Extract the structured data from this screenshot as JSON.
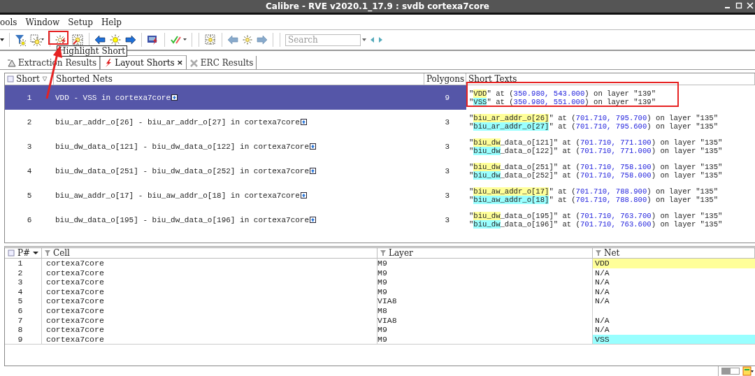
{
  "window": {
    "title": "Calibre - RVE v2020.1_17.9 : svdb cortexa7core"
  },
  "menu": [
    {
      "label": "ools"
    },
    {
      "label": "Window"
    },
    {
      "label": "Setup"
    },
    {
      "label": "Help"
    }
  ],
  "search": {
    "placeholder": "Search"
  },
  "tooltip": "Highlight Short",
  "tabs": [
    {
      "label": "Extraction Results",
      "kind": "extraction",
      "selected": false
    },
    {
      "label": "Layout Shorts",
      "kind": "shorts",
      "selected": true,
      "close": "×"
    },
    {
      "label": "ERC Results",
      "kind": "erc",
      "selected": false
    }
  ],
  "shorts": {
    "columns": [
      "Short",
      "Shorted Nets",
      "Polygons",
      "Short Texts"
    ],
    "rows": [
      {
        "number": "1",
        "nets": "VDD - VSS in cortexa7core",
        "polygons": "9",
        "selected": true,
        "texts": [
          {
            "color": "#ffff99",
            "segments": [
              {
                "kind": "plain",
                "text": "\""
              },
              {
                "kind": "name",
                "text": "VDD"
              },
              {
                "kind": "plain",
                "text": "\" at ("
              },
              {
                "kind": "coord",
                "text": "350.980, 543.000"
              },
              {
                "kind": "plain",
                "text": ") on layer \"139\""
              }
            ]
          },
          {
            "color": "#99ffff",
            "segments": [
              {
                "kind": "plain",
                "text": "\""
              },
              {
                "kind": "name",
                "text": "VSS"
              },
              {
                "kind": "plain",
                "text": "\" at ("
              },
              {
                "kind": "coord",
                "text": "350.980, 551.000"
              },
              {
                "kind": "plain",
                "text": ") on layer \"139\""
              }
            ]
          }
        ]
      },
      {
        "number": "2",
        "nets": "biu_ar_addr_o[26] - biu_ar_addr_o[27] in cortexa7core",
        "polygons": "3",
        "selected": false,
        "texts": [
          {
            "color": "#ffff99",
            "segments": [
              {
                "kind": "plain",
                "text": "\""
              },
              {
                "kind": "name",
                "text": "biu_ar_addr_o[26]"
              },
              {
                "kind": "plain",
                "text": "\" at ("
              },
              {
                "kind": "coord",
                "text": "701.710, 795.700"
              },
              {
                "kind": "plain",
                "text": ") on layer \"135\""
              }
            ]
          },
          {
            "color": "#99ffff",
            "segments": [
              {
                "kind": "plain",
                "text": "\""
              },
              {
                "kind": "name",
                "text": "biu_ar_addr_o[27]"
              },
              {
                "kind": "plain",
                "text": "\" at ("
              },
              {
                "kind": "coord",
                "text": "701.710, 795.600"
              },
              {
                "kind": "plain",
                "text": ") on layer \"135\""
              }
            ]
          }
        ]
      },
      {
        "number": "3",
        "nets": "biu_dw_data_o[121] - biu_dw_data_o[122] in cortexa7core",
        "polygons": "3",
        "selected": false,
        "texts": [
          {
            "color": "#ffff99",
            "segments": [
              {
                "kind": "plain",
                "text": "\""
              },
              {
                "kind": "name",
                "text": "biu_dw"
              },
              {
                "kind": "plain",
                "text": "_data_o[121]\" at ("
              },
              {
                "kind": "coord",
                "text": "701.710, 771.100"
              },
              {
                "kind": "plain",
                "text": ") on layer \"135\""
              }
            ]
          },
          {
            "color": "#99ffff",
            "segments": [
              {
                "kind": "plain",
                "text": "\""
              },
              {
                "kind": "name",
                "text": "biu_dw"
              },
              {
                "kind": "plain",
                "text": "_data_o[122]\" at ("
              },
              {
                "kind": "coord",
                "text": "701.710, 771.000"
              },
              {
                "kind": "plain",
                "text": ") on layer \"135\""
              }
            ]
          }
        ]
      },
      {
        "number": "4",
        "nets": "biu_dw_data_o[251] - biu_dw_data_o[252] in cortexa7core",
        "polygons": "3",
        "selected": false,
        "texts": [
          {
            "color": "#ffff99",
            "segments": [
              {
                "kind": "plain",
                "text": "\""
              },
              {
                "kind": "name",
                "text": "biu_dw"
              },
              {
                "kind": "plain",
                "text": "_data_o[251]\" at ("
              },
              {
                "kind": "coord",
                "text": "701.710, 758.100"
              },
              {
                "kind": "plain",
                "text": ") on layer \"135\""
              }
            ]
          },
          {
            "color": "#99ffff",
            "segments": [
              {
                "kind": "plain",
                "text": "\""
              },
              {
                "kind": "name",
                "text": "biu_dw"
              },
              {
                "kind": "plain",
                "text": "_data_o[252]\" at ("
              },
              {
                "kind": "coord",
                "text": "701.710, 758.000"
              },
              {
                "kind": "plain",
                "text": ") on layer \"135\""
              }
            ]
          }
        ]
      },
      {
        "number": "5",
        "nets": "biu_aw_addr_o[17] - biu_aw_addr_o[18] in cortexa7core",
        "polygons": "3",
        "selected": false,
        "texts": [
          {
            "color": "#ffff99",
            "segments": [
              {
                "kind": "plain",
                "text": "\""
              },
              {
                "kind": "name",
                "text": "biu_aw_addr_o[17]"
              },
              {
                "kind": "plain",
                "text": "\" at ("
              },
              {
                "kind": "coord",
                "text": "701.710, 788.900"
              },
              {
                "kind": "plain",
                "text": ") on layer \"135\""
              }
            ]
          },
          {
            "color": "#99ffff",
            "segments": [
              {
                "kind": "plain",
                "text": "\""
              },
              {
                "kind": "name",
                "text": "biu_aw_addr_o[18]"
              },
              {
                "kind": "plain",
                "text": "\" at ("
              },
              {
                "kind": "coord",
                "text": "701.710, 788.800"
              },
              {
                "kind": "plain",
                "text": ") on layer \"135\""
              }
            ]
          }
        ]
      },
      {
        "number": "6",
        "nets": "biu_dw_data_o[195] - biu_dw_data_o[196] in cortexa7core",
        "polygons": "3",
        "selected": false,
        "texts": [
          {
            "color": "#ffff99",
            "segments": [
              {
                "kind": "plain",
                "text": "\""
              },
              {
                "kind": "name",
                "text": "biu_dw"
              },
              {
                "kind": "plain",
                "text": "_data_o[195]\" at ("
              },
              {
                "kind": "coord",
                "text": "701.710, 763.700"
              },
              {
                "kind": "plain",
                "text": ") on layer \"135\""
              }
            ]
          },
          {
            "color": "#99ffff",
            "segments": [
              {
                "kind": "plain",
                "text": "\""
              },
              {
                "kind": "name",
                "text": "biu_dw"
              },
              {
                "kind": "plain",
                "text": "_data_o[196]\" at ("
              },
              {
                "kind": "coord",
                "text": "701.710, 763.600"
              },
              {
                "kind": "plain",
                "text": ") on layer \"135\""
              }
            ]
          }
        ]
      }
    ]
  },
  "polygons": {
    "columns": [
      "P#",
      "Cell",
      "Layer",
      "Net"
    ],
    "rows": [
      {
        "number": "1",
        "cell": "cortexa7core",
        "layer": "M9",
        "net": "VDD",
        "color": "#ffff99"
      },
      {
        "number": "2",
        "cell": "cortexa7core",
        "layer": "M9",
        "net": "N/A"
      },
      {
        "number": "3",
        "cell": "cortexa7core",
        "layer": "M9",
        "net": "N/A"
      },
      {
        "number": "4",
        "cell": "cortexa7core",
        "layer": "M9",
        "net": "N/A"
      },
      {
        "number": "5",
        "cell": "cortexa7core",
        "layer": "VIA8",
        "net": "N/A"
      },
      {
        "number": "6",
        "cell": "cortexa7core",
        "layer": "M8"
      },
      {
        "number": "7",
        "cell": "cortexa7core",
        "layer": "VIA8",
        "net": "N/A"
      },
      {
        "number": "8",
        "cell": "cortexa7core",
        "layer": "M9",
        "net": "N/A"
      },
      {
        "number": "9",
        "cell": "cortexa7core",
        "layer": "M9",
        "net": "VSS",
        "color": "#99ffff"
      }
    ]
  }
}
